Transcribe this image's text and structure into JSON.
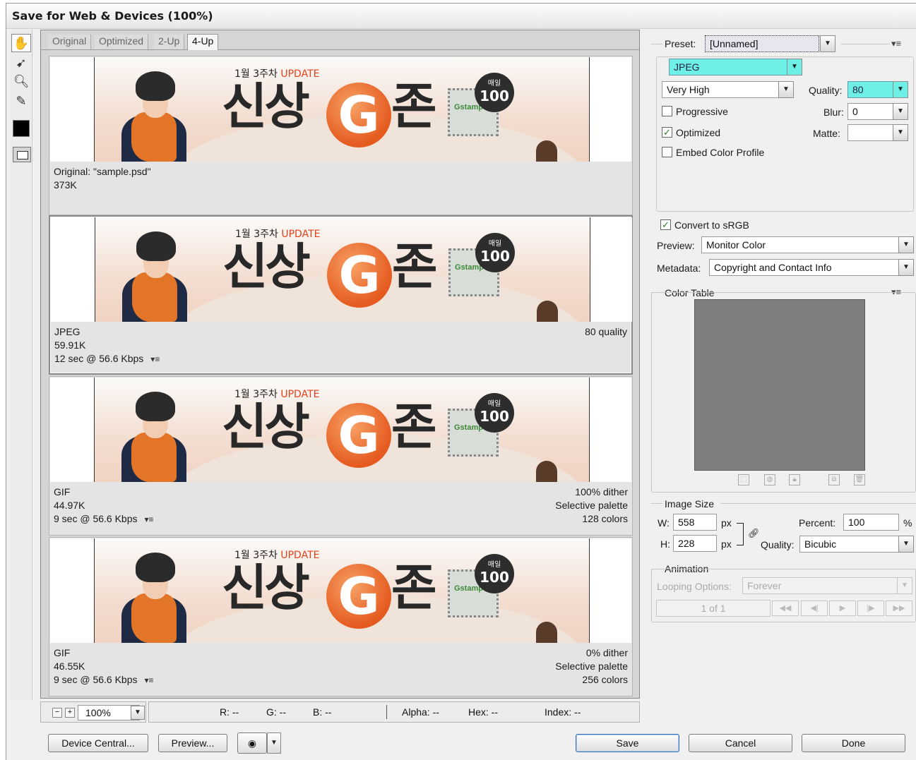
{
  "window": {
    "title": "Save for Web & Devices (100%)"
  },
  "tabs": [
    "Original",
    "Optimized",
    "2-Up",
    "4-Up"
  ],
  "banner": {
    "small_text": "1월 3주차",
    "small_accent": "UPDATE",
    "word_left": "신상",
    "word_g": "G",
    "word_right": "존",
    "badge_top": "매일",
    "badge_num": "100",
    "stamp": "Gstamp"
  },
  "panes": [
    {
      "lines": [
        "Original: \"sample.psd\"",
        "373K"
      ],
      "right": []
    },
    {
      "lines": [
        "JPEG",
        "59.91K",
        "12 sec @ 56.6 Kbps"
      ],
      "right": [
        "80 quality"
      ]
    },
    {
      "lines": [
        "GIF",
        "44.97K",
        "9 sec @ 56.6 Kbps"
      ],
      "right": [
        "100% dither",
        "Selective palette",
        "128 colors"
      ]
    },
    {
      "lines": [
        "GIF",
        "46.55K",
        "9 sec @ 56.6 Kbps"
      ],
      "right": [
        "0% dither",
        "Selective palette",
        "256 colors"
      ]
    }
  ],
  "zoom": {
    "value": "100%"
  },
  "readout": {
    "r": "R: --",
    "g": "G: --",
    "b": "B: --",
    "alpha": "Alpha: --",
    "hex": "Hex: --",
    "index": "Index: --"
  },
  "buttons": {
    "device_central": "Device Central...",
    "preview": "Preview...",
    "save": "Save",
    "cancel": "Cancel",
    "done": "Done"
  },
  "settings": {
    "preset_label": "Preset:",
    "preset_value": "[Unnamed]",
    "format": "JPEG",
    "quality_preset": "Very High",
    "quality_label": "Quality:",
    "quality_value": "80",
    "blur_label": "Blur:",
    "blur_value": "0",
    "matte_label": "Matte:",
    "matte_value": "",
    "progressive": "Progressive",
    "optimized": "Optimized",
    "embed_profile": "Embed Color Profile",
    "convert_srgb": "Convert to sRGB",
    "preview_label": "Preview:",
    "preview_value": "Monitor Color",
    "metadata_label": "Metadata:",
    "metadata_value": "Copyright and Contact Info"
  },
  "checks": {
    "progressive": false,
    "optimized": true,
    "embed_profile": false,
    "convert_srgb": true
  },
  "color_table": {
    "title": "Color Table"
  },
  "image_size": {
    "title": "Image Size",
    "w_label": "W:",
    "w_value": "558",
    "h_label": "H:",
    "h_value": "228",
    "unit": "px",
    "percent_label": "Percent:",
    "percent_value": "100",
    "percent_unit": "%",
    "quality_label": "Quality:",
    "quality_value": "Bicubic"
  },
  "animation": {
    "title": "Animation",
    "looping_label": "Looping Options:",
    "looping_value": "Forever",
    "frame": "1 of 1"
  }
}
